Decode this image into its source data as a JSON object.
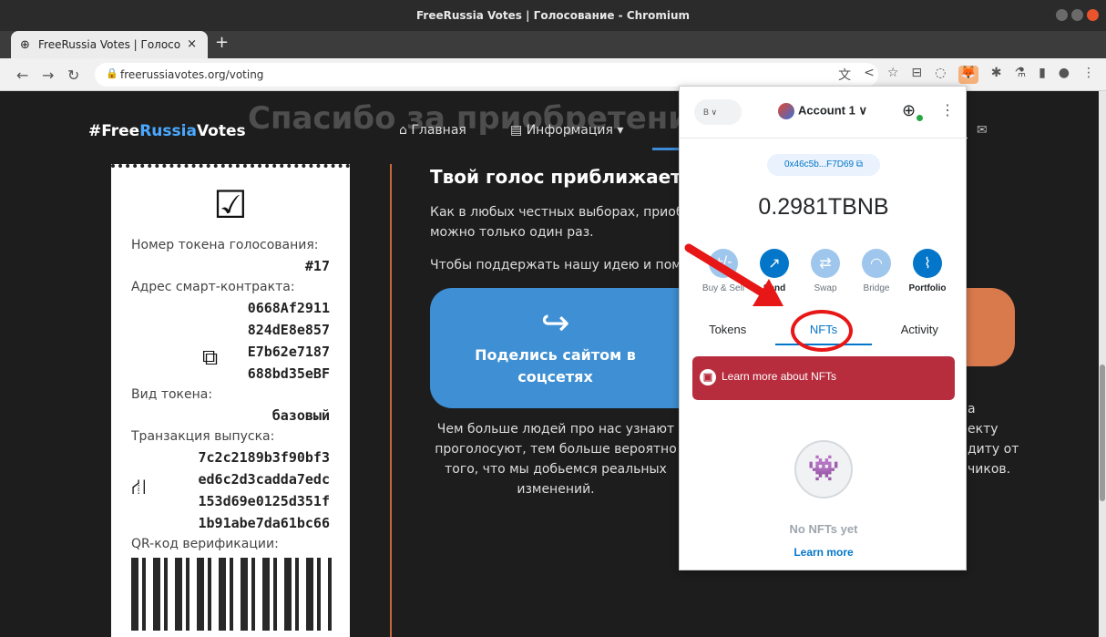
{
  "window": {
    "title": "FreeRussia Votes | Голосование - Chromium"
  },
  "tab": {
    "title": "FreeRussia Votes | Голосо",
    "close": "×",
    "new": "+"
  },
  "toolbar": {
    "url": "freerussiavotes.org/voting"
  },
  "site": {
    "brand_prefix": "#Free",
    "brand_mid": "Russia",
    "brand_suffix": "Votes",
    "ghost_heading": "Спасибо за приобретени",
    "nav": [
      "Главная",
      "Информация"
    ],
    "ticket": {
      "token_number_label": "Номер токена голосования:",
      "token_number": "#17",
      "contract_label": "Адрес смарт-контракта:",
      "contract": [
        "0668Af2911",
        "824dE8e857",
        "E7b62e7187",
        "688bd35eBF"
      ],
      "token_type_label": "Вид токена:",
      "token_type": "базовый",
      "tx_label": "Транзакция выпуска:",
      "tx": [
        "7c2c2189b3f90bf3",
        "ed6c2d3cadda7edc",
        "153d69e0125d351f",
        "1b91abe7da61bc66"
      ],
      "qr_label": "QR-код верификации:"
    },
    "section_title": "Твой голос приближает",
    "para1a": "Как в любых честных выборах, приоб",
    "para1b": "можно только один раз.",
    "para2": "Чтобы поддержать нашу идею и пом",
    "share_label_1": "Поделись сайтом в",
    "share_label_2": "соцсетях",
    "bottom": [
      "Чем больше людей про нас узнают",
      "проголосуют, тем больше вероятно",
      "того, что мы добьемся реальных",
      "изменений."
    ],
    "right_text": [
      "а",
      "екту",
      "диту от",
      "чиков."
    ]
  },
  "wallet": {
    "network": "B",
    "account": "Account 1",
    "address": "0x46c5b...F7D69",
    "balance": "0.2981TBNB",
    "actions": [
      {
        "label": "Buy & Sell",
        "icon": "+/-"
      },
      {
        "label": "Send",
        "icon": "↗"
      },
      {
        "label": "Swap",
        "icon": "⇄"
      },
      {
        "label": "Bridge",
        "icon": "◠"
      },
      {
        "label": "Portfolio",
        "icon": "⌇"
      }
    ],
    "tabs": [
      "Tokens",
      "NFTs",
      "Activity"
    ],
    "banner": "Learn more about NFTs",
    "empty": "No NFTs yet",
    "learn_more": "Learn more"
  },
  "colors": {
    "accent": "#0376c9",
    "highlight": "#e81717",
    "brand_blue": "#4aa8ff",
    "banner": "#b72d3e"
  }
}
